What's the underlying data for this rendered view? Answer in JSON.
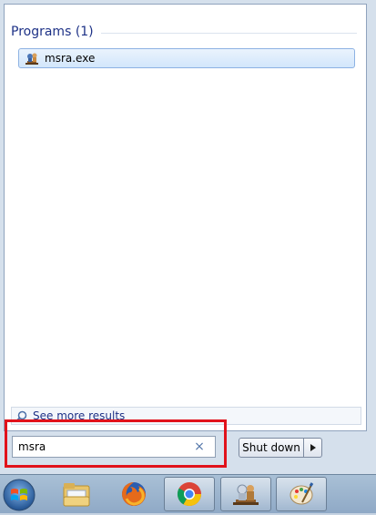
{
  "results": {
    "section_title": "Programs (1)",
    "items": [
      {
        "label": "msra.exe",
        "icon": "remote-assistance-icon"
      }
    ],
    "see_more_label": "See more results"
  },
  "search": {
    "value": "msra",
    "clear_symbol": "×"
  },
  "shutdown": {
    "label": "Shut down"
  },
  "taskbar": {
    "items": [
      {
        "name": "start-orb",
        "icon": "windows-logo-icon"
      },
      {
        "name": "explorer",
        "icon": "folder-icon"
      },
      {
        "name": "firefox",
        "icon": "firefox-icon"
      },
      {
        "name": "chrome",
        "icon": "chrome-icon"
      },
      {
        "name": "remote-assistance",
        "icon": "remote-assistance-icon"
      },
      {
        "name": "paint",
        "icon": "palette-icon"
      }
    ]
  },
  "colors": {
    "highlight": "#e1121b",
    "section_title": "#1e3287"
  }
}
